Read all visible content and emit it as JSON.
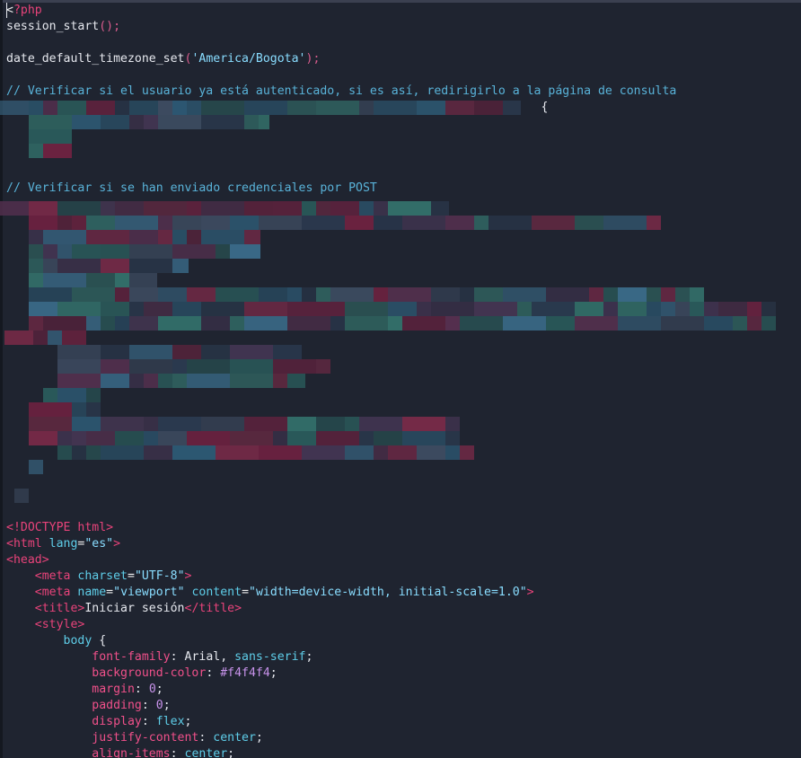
{
  "colors": {
    "background": "#1f2430",
    "plain": "#e6e8ee",
    "string": "#89ddff",
    "comment": "#59b3d9",
    "tag": "#e8437a",
    "attribute": "#5ecde8",
    "css_property": "#f0508a",
    "number": "#c792ea"
  },
  "lines": [
    {
      "row": 0,
      "tokens": [
        {
          "t": "<",
          "c": "punc"
        },
        {
          "t": "?php",
          "c": "tag"
        }
      ]
    },
    {
      "row": 1,
      "tokens": [
        {
          "t": "session_start",
          "c": "plain"
        },
        {
          "t": "();",
          "c": "paren"
        }
      ]
    },
    {
      "row": 3,
      "tokens": [
        {
          "t": "date_default_timezone_set",
          "c": "plain"
        },
        {
          "t": "(",
          "c": "paren"
        },
        {
          "t": "'America/Bogota'",
          "c": "str"
        },
        {
          "t": ");",
          "c": "paren"
        }
      ]
    },
    {
      "row": 5,
      "tokens": [
        {
          "t": "// Verificar si el usuario ya está autenticado, si es así, redirigirlo a la página de consulta",
          "c": "comment"
        }
      ]
    },
    {
      "row": 6,
      "tokens": [
        {
          "t": "                                                                           {",
          "c": "plain"
        }
      ]
    },
    {
      "row": 11,
      "tokens": [
        {
          "t": "// Verificar si se han enviado credenciales por POST",
          "c": "comment"
        }
      ]
    },
    {
      "row": 32,
      "tokens": [
        {
          "t": "<!DOCTYPE html>",
          "c": "tag"
        }
      ]
    },
    {
      "row": 33,
      "tokens": [
        {
          "t": "<html ",
          "c": "tag"
        },
        {
          "t": "lang",
          "c": "attr"
        },
        {
          "t": "=",
          "c": "punc"
        },
        {
          "t": "\"es\"",
          "c": "str"
        },
        {
          "t": ">",
          "c": "tag"
        }
      ]
    },
    {
      "row": 34,
      "tokens": [
        {
          "t": "<head>",
          "c": "tag"
        }
      ]
    },
    {
      "row": 35,
      "tokens": [
        {
          "t": "    <meta ",
          "c": "tag"
        },
        {
          "t": "charset",
          "c": "attr"
        },
        {
          "t": "=",
          "c": "punc"
        },
        {
          "t": "\"UTF-8\"",
          "c": "str"
        },
        {
          "t": ">",
          "c": "tag"
        }
      ]
    },
    {
      "row": 36,
      "tokens": [
        {
          "t": "    <meta ",
          "c": "tag"
        },
        {
          "t": "name",
          "c": "attr"
        },
        {
          "t": "=",
          "c": "punc"
        },
        {
          "t": "\"viewport\"",
          "c": "str"
        },
        {
          "t": " ",
          "c": "plain"
        },
        {
          "t": "content",
          "c": "attr"
        },
        {
          "t": "=",
          "c": "punc"
        },
        {
          "t": "\"width=device-width, initial-scale=1.0\"",
          "c": "str"
        },
        {
          "t": ">",
          "c": "tag"
        }
      ]
    },
    {
      "row": 37,
      "tokens": [
        {
          "t": "    <title>",
          "c": "tag"
        },
        {
          "t": "Iniciar sesión",
          "c": "plain"
        },
        {
          "t": "</title>",
          "c": "tag"
        }
      ]
    },
    {
      "row": 38,
      "tokens": [
        {
          "t": "    <style>",
          "c": "tag"
        }
      ]
    },
    {
      "row": 39,
      "tokens": [
        {
          "t": "        body ",
          "c": "attr"
        },
        {
          "t": "{",
          "c": "plain"
        }
      ]
    },
    {
      "row": 40,
      "tokens": [
        {
          "t": "            font-family",
          "c": "prop"
        },
        {
          "t": ": Arial, ",
          "c": "plain"
        },
        {
          "t": "sans-serif",
          "c": "val"
        },
        {
          "t": ";",
          "c": "plain"
        }
      ]
    },
    {
      "row": 41,
      "tokens": [
        {
          "t": "            background-color",
          "c": "prop"
        },
        {
          "t": ": ",
          "c": "plain"
        },
        {
          "t": "#f4f4f4",
          "c": "num"
        },
        {
          "t": ";",
          "c": "plain"
        }
      ]
    },
    {
      "row": 42,
      "tokens": [
        {
          "t": "            margin",
          "c": "prop"
        },
        {
          "t": ": ",
          "c": "plain"
        },
        {
          "t": "0",
          "c": "num"
        },
        {
          "t": ";",
          "c": "plain"
        }
      ]
    },
    {
      "row": 43,
      "tokens": [
        {
          "t": "            padding",
          "c": "prop"
        },
        {
          "t": ": ",
          "c": "plain"
        },
        {
          "t": "0",
          "c": "num"
        },
        {
          "t": ";",
          "c": "plain"
        }
      ]
    },
    {
      "row": 44,
      "tokens": [
        {
          "t": "            display",
          "c": "prop"
        },
        {
          "t": ": ",
          "c": "plain"
        },
        {
          "t": "flex",
          "c": "val"
        },
        {
          "t": ";",
          "c": "plain"
        }
      ]
    },
    {
      "row": 45,
      "tokens": [
        {
          "t": "            justify-content",
          "c": "prop"
        },
        {
          "t": ": ",
          "c": "plain"
        },
        {
          "t": "center",
          "c": "val"
        },
        {
          "t": ";",
          "c": "plain"
        }
      ]
    },
    {
      "row": 46,
      "tokens": [
        {
          "t": "            align-items",
          "c": "prop"
        },
        {
          "t": ": ",
          "c": "plain"
        },
        {
          "t": "center",
          "c": "val"
        },
        {
          "t": ";",
          "c": "plain"
        }
      ]
    }
  ]
}
